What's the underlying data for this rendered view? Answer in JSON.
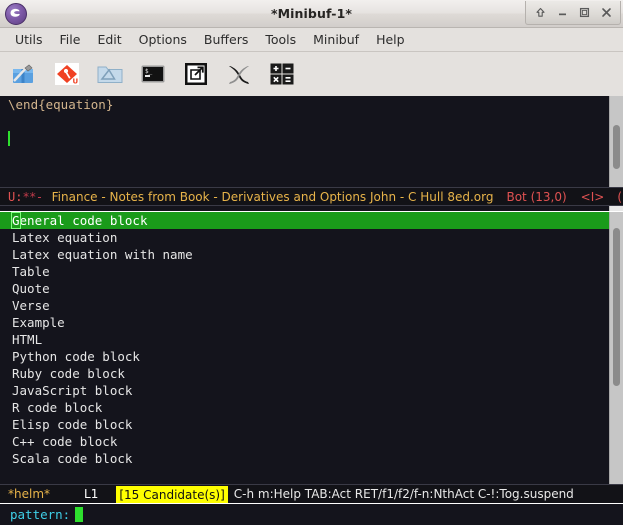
{
  "window": {
    "title": "*Minibuf-1*",
    "logo_icon": "emacs-logo-icon",
    "buttons": [
      {
        "name": "shade-button",
        "icon": "arrow-up-icon",
        "label": "Shade"
      },
      {
        "name": "minimize-button",
        "icon": "minimize-icon",
        "label": "Minimize"
      },
      {
        "name": "maximize-button",
        "icon": "maximize-icon",
        "label": "Maximize"
      },
      {
        "name": "close-button",
        "icon": "close-icon",
        "label": "Close"
      }
    ]
  },
  "menubar": {
    "items": [
      {
        "label": "Utils"
      },
      {
        "label": "File"
      },
      {
        "label": "Edit"
      },
      {
        "label": "Options"
      },
      {
        "label": "Buffers"
      },
      {
        "label": "Tools"
      },
      {
        "label": "Minibuf"
      },
      {
        "label": "Help"
      }
    ]
  },
  "toolbar": {
    "items": [
      {
        "icon": "package-tools-icon",
        "label": "Package Tools"
      },
      {
        "icon": "magit-diamond-icon",
        "label": "Magit"
      },
      {
        "icon": "folder-dired-icon",
        "label": "Dired"
      },
      {
        "icon": "terminal-icon",
        "label": "Terminal"
      },
      {
        "icon": "external-window-icon",
        "label": "Open External"
      },
      {
        "icon": "x-latex-icon",
        "label": "LaTeX"
      },
      {
        "icon": "calculator-icon",
        "label": "Calculator"
      }
    ]
  },
  "editor": {
    "lines": [
      "\\end{equation}",
      "",
      ""
    ],
    "cursor_line_index": 2,
    "scrollbar": {
      "thumb_top_pct": 32,
      "thumb_height_pct": 48
    }
  },
  "modeline": {
    "coding": "U:",
    "status": "**-",
    "buffer_name": "Finance - Notes from Book - Derivatives and Options John - C Hull 8ed.org",
    "position": "Bot (13,0)",
    "input_method": "<I>",
    "trailing": "("
  },
  "helm": {
    "candidates": [
      {
        "label": "General code block",
        "selected": true
      },
      {
        "label": "Latex equation",
        "selected": false
      },
      {
        "label": "Latex equation with name",
        "selected": false
      },
      {
        "label": "Table",
        "selected": false
      },
      {
        "label": "Quote",
        "selected": false
      },
      {
        "label": "Verse",
        "selected": false
      },
      {
        "label": "Example",
        "selected": false
      },
      {
        "label": "HTML",
        "selected": false
      },
      {
        "label": "Python code block",
        "selected": false
      },
      {
        "label": "Ruby code block",
        "selected": false
      },
      {
        "label": "JavaScript block",
        "selected": false
      },
      {
        "label": "R code block",
        "selected": false
      },
      {
        "label": "Elisp code block",
        "selected": false
      },
      {
        "label": "C++ code block",
        "selected": false
      },
      {
        "label": "Scala code block",
        "selected": false
      }
    ],
    "scrollbar": {
      "thumb_top_pct": 6,
      "thumb_height_pct": 58
    },
    "modeline": {
      "buffer_name": "*helm*",
      "line_number": "L1",
      "candidate_count": "[15 Candidate(s)]",
      "keybindings": "C-h m:Help TAB:Act RET/f1/f2/f-n:NthAct C-!:Tog.suspend"
    }
  },
  "minibuffer": {
    "prompt": "pattern:",
    "value": ""
  },
  "colors": {
    "selection_green": "#1a9b1a",
    "count_yellow": "#ffff00",
    "buffer_name_yellow": "#e8b44a",
    "modeline_red": "#e05252",
    "cursor_green": "#2ee02e",
    "prompt_cyan": "#3fd0e8",
    "background_dark": "#14141c",
    "chrome_grey": "#e4e1de"
  }
}
